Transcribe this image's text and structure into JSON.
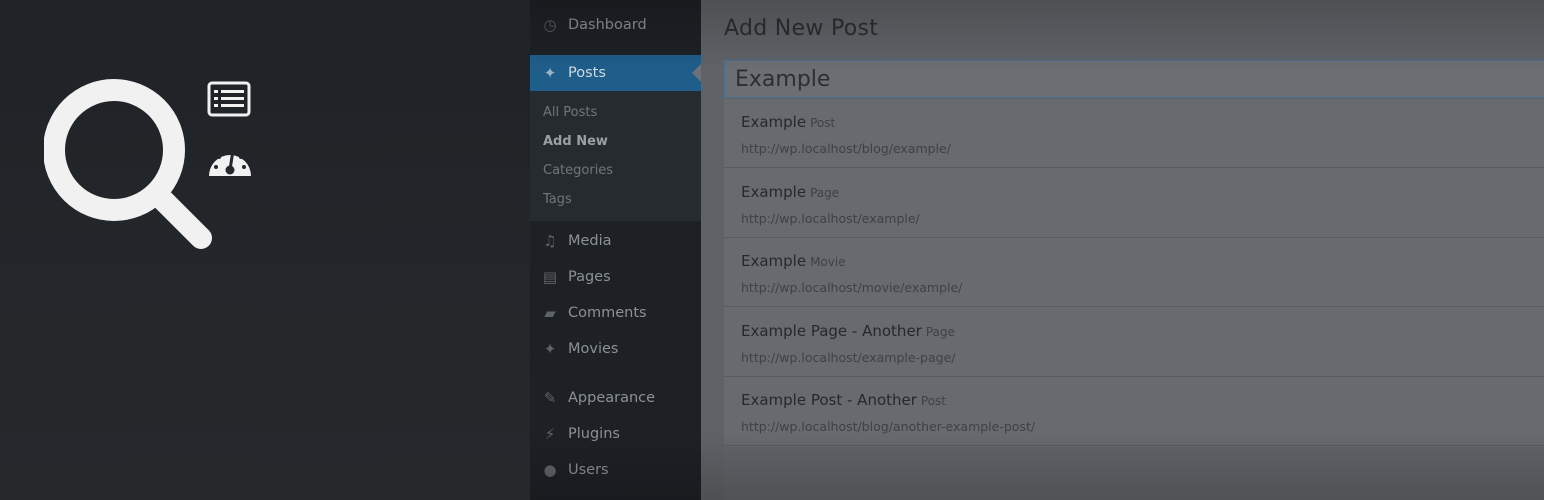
{
  "branding": {
    "icons": [
      "search-icon",
      "list-icon",
      "dashboard-gauge-icon"
    ],
    "colors": {
      "icon": "#f1f1f1",
      "background": "#23282d"
    }
  },
  "sidebar": {
    "items": [
      {
        "label": "Dashboard",
        "icon": "dashboard-icon"
      },
      {
        "label": "Posts",
        "icon": "pin-icon",
        "active": true
      },
      {
        "label": "Media",
        "icon": "media-icon"
      },
      {
        "label": "Pages",
        "icon": "pages-icon"
      },
      {
        "label": "Comments",
        "icon": "comment-icon"
      },
      {
        "label": "Movies",
        "icon": "pin-icon"
      },
      {
        "label": "Appearance",
        "icon": "brush-icon"
      },
      {
        "label": "Plugins",
        "icon": "plugin-icon"
      },
      {
        "label": "Users",
        "icon": "user-icon"
      }
    ],
    "submenu": [
      "All Posts",
      "Add New",
      "Categories",
      "Tags"
    ],
    "current_submenu": "Add New",
    "colors": {
      "active": "#1f5d8a",
      "background": "#1d2125"
    }
  },
  "main": {
    "title": "Add New Post",
    "search": {
      "value": "Example"
    },
    "results": [
      {
        "title": "Example",
        "type": "Post",
        "url": "http://wp.localhost/blog/example/"
      },
      {
        "title": "Example",
        "type": "Page",
        "url": "http://wp.localhost/example/"
      },
      {
        "title": "Example",
        "type": "Movie",
        "url": "http://wp.localhost/movie/example/"
      },
      {
        "title": "Example Page - Another",
        "type": "Page",
        "url": "http://wp.localhost/example-page/"
      },
      {
        "title": "Example Post - Another",
        "type": "Post",
        "url": "http://wp.localhost/blog/another-example-post/"
      }
    ]
  }
}
